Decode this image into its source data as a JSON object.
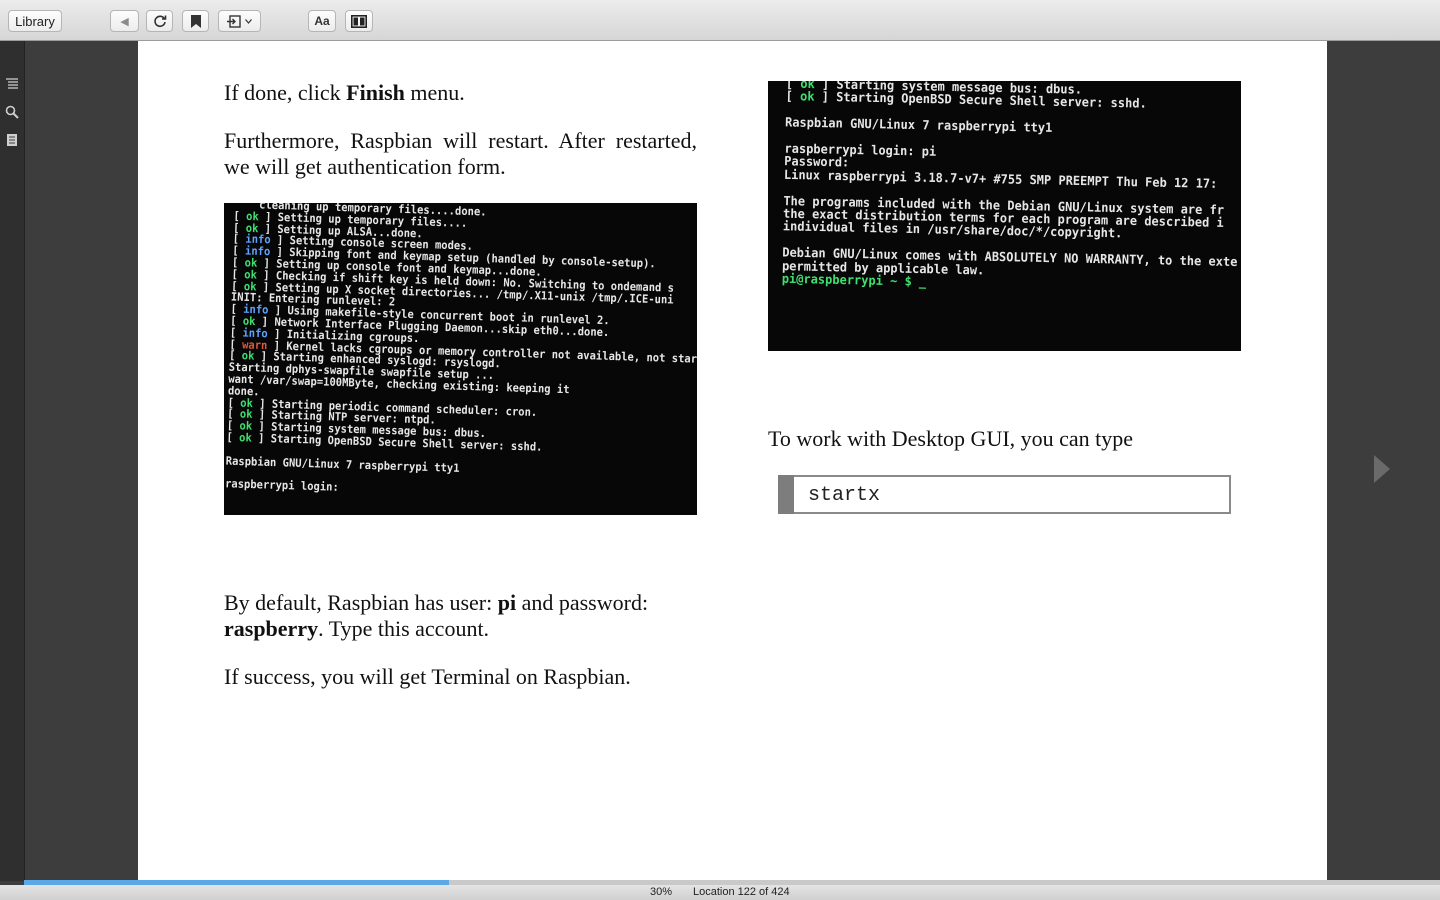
{
  "toolbar": {
    "library_label": "Library",
    "font_label": "Aa"
  },
  "content": {
    "left": {
      "p1_pre": "If done, click ",
      "p1_bold": "Finish",
      "p1_post": " menu.",
      "p2": "Furthermore, Raspbian will restart. After restarted, we will get authentication form.",
      "p3_pre": "By default, Raspbian has user: ",
      "p3_bold1": "pi",
      "p3_mid": " and password: ",
      "p3_bold2": "raspberry",
      "p3_post": ". Type this account.",
      "p4": "If success, you will get Terminal on Raspbian.",
      "terminal_lines": [
        {
          "tag": "",
          "text": "    cleaning up temporary files....done."
        },
        {
          "tag": "ok",
          "text": "Setting up temporary files...."
        },
        {
          "tag": "ok",
          "text": "Setting up ALSA...done."
        },
        {
          "tag": "info",
          "text": "Setting console screen modes."
        },
        {
          "tag": "info",
          "text": "Skipping font and keymap setup (handled by console-setup)."
        },
        {
          "tag": "ok",
          "text": "Setting up console font and keymap...done."
        },
        {
          "tag": "ok",
          "text": "Checking if shift key is held down: No. Switching to ondemand s"
        },
        {
          "tag": "ok",
          "text": "Setting up X socket directories... /tmp/.X11-unix /tmp/.ICE-uni"
        },
        {
          "tag": "",
          "text": "INIT: Entering runlevel: 2"
        },
        {
          "tag": "info",
          "text": "Using makefile-style concurrent boot in runlevel 2."
        },
        {
          "tag": "ok",
          "text": "Network Interface Plugging Daemon...skip eth0...done."
        },
        {
          "tag": "info",
          "text": "Initializing cgroups."
        },
        {
          "tag": "warn",
          "text": "Kernel lacks cgroups or memory controller not available, not start"
        },
        {
          "tag": "ok",
          "text": "Starting enhanced syslogd: rsyslogd."
        },
        {
          "tag": "",
          "text": "Starting dphys-swapfile swapfile setup ..."
        },
        {
          "tag": "",
          "text": "want /var/swap=100MByte, checking existing: keeping it"
        },
        {
          "tag": "",
          "text": "done."
        },
        {
          "tag": "ok",
          "text": "Starting periodic command scheduler: cron."
        },
        {
          "tag": "ok",
          "text": "Starting NTP server: ntpd."
        },
        {
          "tag": "ok",
          "text": "Starting system message bus: dbus."
        },
        {
          "tag": "ok",
          "text": "Starting OpenBSD Secure Shell server: sshd."
        },
        {
          "tag": "",
          "text": ""
        },
        {
          "tag": "",
          "text": "Raspbian GNU/Linux 7 raspberrypi tty1"
        },
        {
          "tag": "",
          "text": ""
        },
        {
          "tag": "",
          "text": "raspberrypi login:"
        }
      ]
    },
    "right": {
      "terminal_lines": [
        {
          "tag": "ok",
          "text": "Starting system message bus: dbus."
        },
        {
          "tag": "ok",
          "text": "Starting OpenBSD Secure Shell server: sshd."
        },
        {
          "tag": "",
          "text": ""
        },
        {
          "tag": "",
          "text": "Raspbian GNU/Linux 7 raspberrypi tty1"
        },
        {
          "tag": "",
          "text": ""
        },
        {
          "tag": "",
          "text": "raspberrypi login: pi"
        },
        {
          "tag": "",
          "text": "Password:"
        },
        {
          "tag": "",
          "text": "Linux raspberrypi 3.18.7-v7+ #755 SMP PREEMPT Thu Feb 12 17:"
        },
        {
          "tag": "",
          "text": ""
        },
        {
          "tag": "",
          "text": "The programs included with the Debian GNU/Linux system are fr"
        },
        {
          "tag": "",
          "text": "the exact distribution terms for each program are described i"
        },
        {
          "tag": "",
          "text": "individual files in /usr/share/doc/*/copyright."
        },
        {
          "tag": "",
          "text": ""
        },
        {
          "tag": "",
          "text": "Debian GNU/Linux comes with ABSOLUTELY NO WARRANTY, to the exte"
        },
        {
          "tag": "",
          "text": "permitted by applicable law."
        },
        {
          "tag": "prompt",
          "text": "pi@raspberrypi ~ $ _"
        }
      ],
      "p1": "To work with Desktop GUI, you can type",
      "code": "startx"
    }
  },
  "status": {
    "percent": "30%",
    "location": "Location 122 of 424",
    "progress_fraction": 0.3
  },
  "colors": {
    "progress": "#5aa9e6",
    "terminal_ok": "#3fe070",
    "terminal_info": "#5fa3ff",
    "terminal_warn": "#e0583b"
  },
  "icons": {
    "back": "triangle-left-icon",
    "refresh": "refresh-icon",
    "bookmark": "bookmark-icon",
    "goto": "goto-icon",
    "view": "two-page-view-icon",
    "toc": "table-of-contents-icon",
    "search": "search-icon",
    "notes": "notes-icon",
    "next": "next-page-icon"
  }
}
